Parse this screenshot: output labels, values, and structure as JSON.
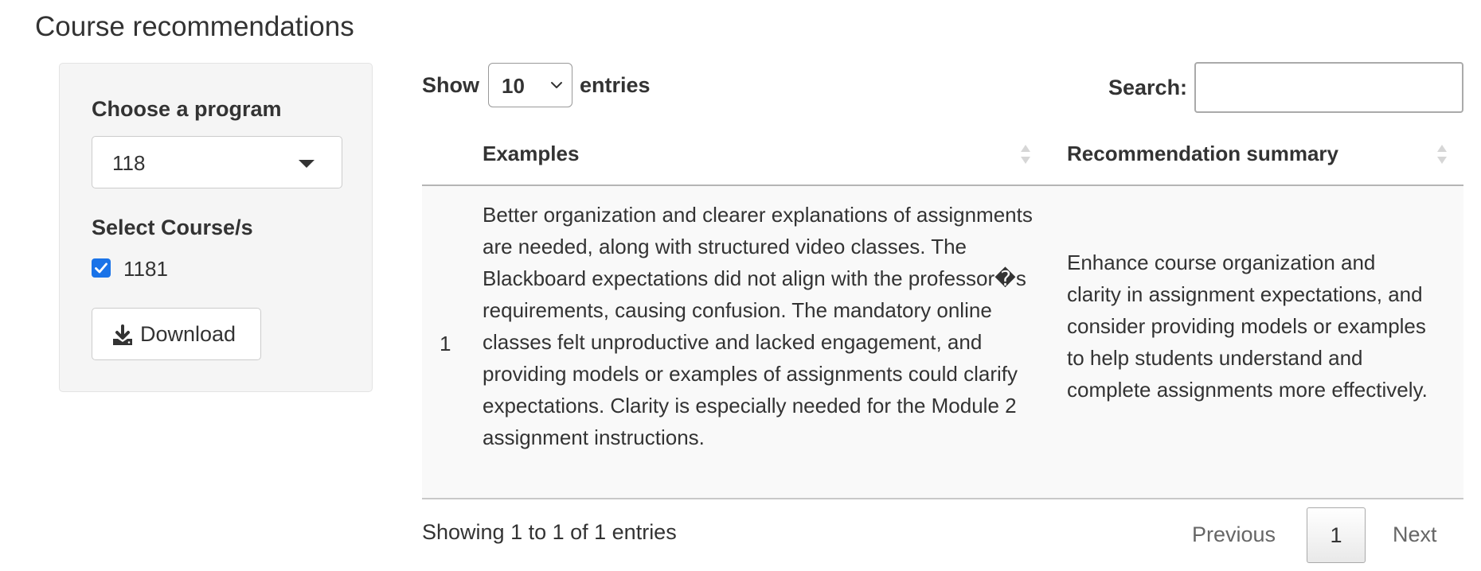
{
  "page": {
    "title": "Course recommendations"
  },
  "sidebar": {
    "program_label": "Choose a program",
    "program_value": "118",
    "course_label": "Select Course/s",
    "courses": [
      {
        "label": "1181",
        "checked": true
      }
    ],
    "download_label": "Download"
  },
  "table_controls": {
    "show_label": "Show",
    "page_length": "10",
    "entries_label": "entries",
    "search_label": "Search:",
    "search_value": ""
  },
  "table": {
    "columns": [
      "Examples",
      "Recommendation summary"
    ],
    "rows": [
      {
        "index": "1",
        "examples": "Better organization and clearer explanations of assignments are needed, along with structured video classes. The Blackboard expectations did not align with the professor�s requirements, causing confusion. The mandatory online classes felt unproductive and lacked engagement, and providing models or examples of assignments could clarify expectations. Clarity is especially needed for the Module 2 assignment instructions.",
        "summary": "Enhance course organization and clarity in assignment expectations, and consider providing models or examples to help students understand and complete assignments more effectively."
      }
    ]
  },
  "footer": {
    "info": "Showing 1 to 1 of 1 entries",
    "previous_label": "Previous",
    "current_page": "1",
    "next_label": "Next"
  },
  "colors": {
    "checkbox_accent": "#1a73e8",
    "row_stripe": "#f9f9f9",
    "well_background": "#f5f5f5"
  },
  "icons": {
    "program_select": "caret-down-icon",
    "length_select": "chevron-down-icon",
    "download": "download-icon",
    "sort": "sort-icon"
  }
}
